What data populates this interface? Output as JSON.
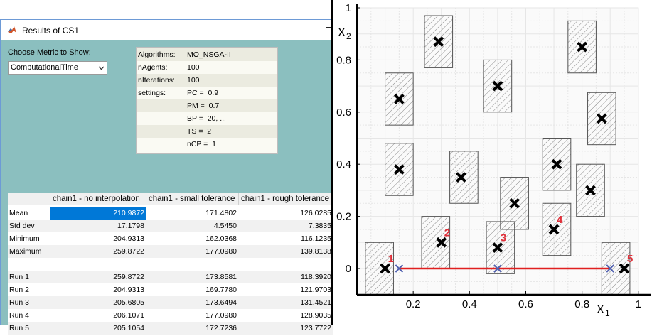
{
  "window": {
    "title": "Results of CS1",
    "minimize_glyph": "–",
    "icon": "matlab-icon"
  },
  "metric": {
    "label": "Choose Metric to Show:",
    "selected": "ComputationalTime",
    "arrow_icon": "chevron-down-icon"
  },
  "info": [
    {
      "key": "Algorithms:",
      "value": "MO_NSGA-II"
    },
    {
      "key": "nAgents:",
      "value": "100"
    },
    {
      "key": "nIterations:",
      "value": "100"
    },
    {
      "key": "settings:",
      "value": "PC =  0.9"
    },
    {
      "key": "",
      "value": "PM =  0.7"
    },
    {
      "key": "",
      "value": "BP =  20, ..."
    },
    {
      "key": "",
      "value": "TS =  2"
    },
    {
      "key": "",
      "value": "nCP =  1"
    }
  ],
  "table": {
    "columns": [
      "",
      "chain1 - no interpolation",
      "chain1 - small tolerance",
      "chain1 - rough tolerance"
    ],
    "rows": [
      {
        "label": "Mean",
        "values": [
          "210.9872",
          "171.4802",
          "126.0285"
        ],
        "selected_col": 0
      },
      {
        "label": "Std dev",
        "values": [
          "17.1798",
          "4.5450",
          "7.3835"
        ]
      },
      {
        "label": "Minimum",
        "values": [
          "204.9313",
          "162.0368",
          "116.1235"
        ]
      },
      {
        "label": "Maximum",
        "values": [
          "259.8722",
          "177.0980",
          "139.8138"
        ]
      },
      {
        "label": "",
        "values": [
          "",
          "",
          ""
        ]
      },
      {
        "label": "Run 1",
        "values": [
          "259.8722",
          "173.8581",
          "118.3920"
        ]
      },
      {
        "label": "Run 2",
        "values": [
          "204.9313",
          "169.7780",
          "121.9703"
        ]
      },
      {
        "label": "Run 3",
        "values": [
          "205.6805",
          "173.6494",
          "131.4521"
        ]
      },
      {
        "label": "Run 4",
        "values": [
          "206.1071",
          "177.0980",
          "128.9035"
        ]
      },
      {
        "label": "Run 5",
        "values": [
          "205.1054",
          "172.7236",
          "123.7722"
        ]
      }
    ]
  },
  "chart_data": {
    "type": "scatter",
    "xlabel": "x",
    "xlabel_sub": "1",
    "ylabel": "x",
    "ylabel_sub": "2",
    "xlim": [
      0,
      1
    ],
    "ylim": [
      -0.1,
      1
    ],
    "x_ticks": [
      "0.2",
      "0.4",
      "0.6",
      "0.8",
      "1"
    ],
    "y_ticks": [
      "0",
      "0.2",
      "0.4",
      "0.6",
      "0.8",
      "1"
    ],
    "grid": true,
    "colors": {
      "obstacle": "#666666",
      "path": "#e02020",
      "numbers": "#e0303a",
      "waypoint": "#5060b0"
    },
    "obstacles": [
      {
        "x0": 0.03,
        "x1": 0.13,
        "y0": -0.1,
        "y1": 0.1
      },
      {
        "x0": 0.23,
        "x1": 0.33,
        "y0": 0.0,
        "y1": 0.2
      },
      {
        "x0": 0.46,
        "x1": 0.56,
        "y0": -0.02,
        "y1": 0.18
      },
      {
        "x0": 0.66,
        "x1": 0.76,
        "y0": 0.05,
        "y1": 0.25
      },
      {
        "x0": 0.87,
        "x1": 0.97,
        "y0": -0.1,
        "y1": 0.1
      },
      {
        "x0": 0.1,
        "x1": 0.2,
        "y0": 0.28,
        "y1": 0.48
      },
      {
        "x0": 0.33,
        "x1": 0.43,
        "y0": 0.25,
        "y1": 0.45
      },
      {
        "x0": 0.51,
        "x1": 0.61,
        "y0": 0.15,
        "y1": 0.35
      },
      {
        "x0": 0.66,
        "x1": 0.76,
        "y0": 0.3,
        "y1": 0.5
      },
      {
        "x0": 0.78,
        "x1": 0.88,
        "y0": 0.2,
        "y1": 0.4
      },
      {
        "x0": 0.1,
        "x1": 0.2,
        "y0": 0.55,
        "y1": 0.75
      },
      {
        "x0": 0.45,
        "x1": 0.55,
        "y0": 0.6,
        "y1": 0.8
      },
      {
        "x0": 0.82,
        "x1": 0.92,
        "y0": 0.475,
        "y1": 0.675
      },
      {
        "x0": 0.24,
        "x1": 0.34,
        "y0": 0.77,
        "y1": 0.97
      },
      {
        "x0": 0.75,
        "x1": 0.85,
        "y0": 0.75,
        "y1": 0.95
      }
    ],
    "black_points": [
      {
        "x": 0.1,
        "y": 0.0,
        "label": "1"
      },
      {
        "x": 0.3,
        "y": 0.1,
        "label": "2"
      },
      {
        "x": 0.5,
        "y": 0.08,
        "label": "3"
      },
      {
        "x": 0.7,
        "y": 0.15,
        "label": "4"
      },
      {
        "x": 0.95,
        "y": 0.0,
        "label": "5"
      },
      {
        "x": 0.15,
        "y": 0.38
      },
      {
        "x": 0.37,
        "y": 0.35
      },
      {
        "x": 0.56,
        "y": 0.25
      },
      {
        "x": 0.71,
        "y": 0.4
      },
      {
        "x": 0.83,
        "y": 0.3
      },
      {
        "x": 0.15,
        "y": 0.65
      },
      {
        "x": 0.5,
        "y": 0.7
      },
      {
        "x": 0.87,
        "y": 0.575
      },
      {
        "x": 0.29,
        "y": 0.87
      },
      {
        "x": 0.8,
        "y": 0.85
      }
    ],
    "path": {
      "x0": 0.15,
      "x1": 0.9,
      "y": 0.0
    },
    "waypoints": [
      {
        "x": 0.15,
        "y": 0.0
      },
      {
        "x": 0.5,
        "y": 0.0
      },
      {
        "x": 0.9,
        "y": 0.0
      }
    ]
  }
}
